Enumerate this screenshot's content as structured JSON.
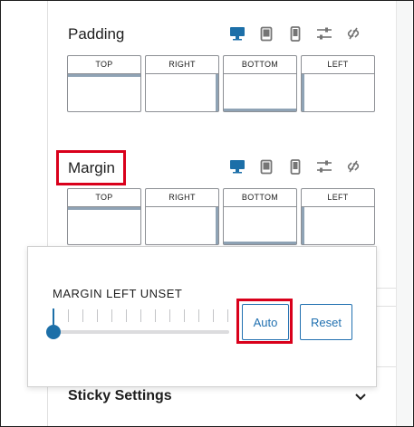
{
  "padding": {
    "title": "Padding",
    "sides": [
      {
        "label": "TOP",
        "value": ""
      },
      {
        "label": "RIGHT",
        "value": ""
      },
      {
        "label": "BOTTOM",
        "value": ""
      },
      {
        "label": "LEFT",
        "value": ""
      }
    ]
  },
  "margin": {
    "title": "Margin",
    "sides": [
      {
        "label": "TOP",
        "value": ""
      },
      {
        "label": "RIGHT",
        "value": ""
      },
      {
        "label": "BOTTOM",
        "value": ""
      },
      {
        "label": "LEFT",
        "value": ""
      }
    ]
  },
  "device_icons": [
    "desktop-icon",
    "tablet-icon",
    "mobile-icon",
    "sliders-icon",
    "unlink-icon"
  ],
  "popover": {
    "title": "MARGIN LEFT UNSET",
    "slider_value": 0,
    "auto_label": "Auto",
    "reset_label": "Reset"
  },
  "sticky": {
    "title": "Sticky Settings"
  },
  "colors": {
    "accent": "#2271b1",
    "highlight": "#d9001b",
    "slider_thumb": "#1c6fa8"
  }
}
